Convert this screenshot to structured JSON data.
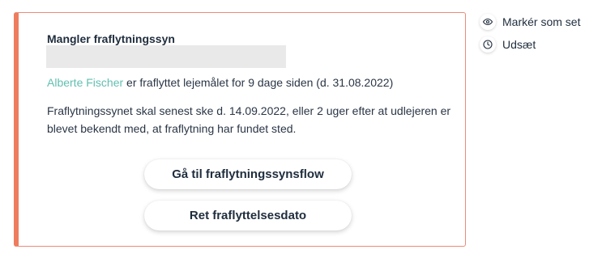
{
  "card": {
    "title": "Mangler fraflytningssyn",
    "tenant_name": "Alberte Fischer",
    "moved_out_text": " er fraflyttet lejemålet for 9 dage siden (d. 31.08.2022)",
    "deadline_text": "Fraflytningssynet skal senest ske d. 14.09.2022, eller 2 uger efter at udlejeren er blevet bekendt med, at fraflytning har fundet sted.",
    "primary_button": "Gå til fraflytningssynsflow",
    "secondary_button": "Ret fraflyttelsesdato"
  },
  "side_actions": [
    {
      "label": "Markér som set",
      "icon": "eye-icon"
    },
    {
      "label": "Udsæt",
      "icon": "clock-icon"
    }
  ],
  "colors": {
    "accent_border": "#ee7c5e",
    "link": "#62bfb1",
    "text": "#1f2d3d"
  }
}
